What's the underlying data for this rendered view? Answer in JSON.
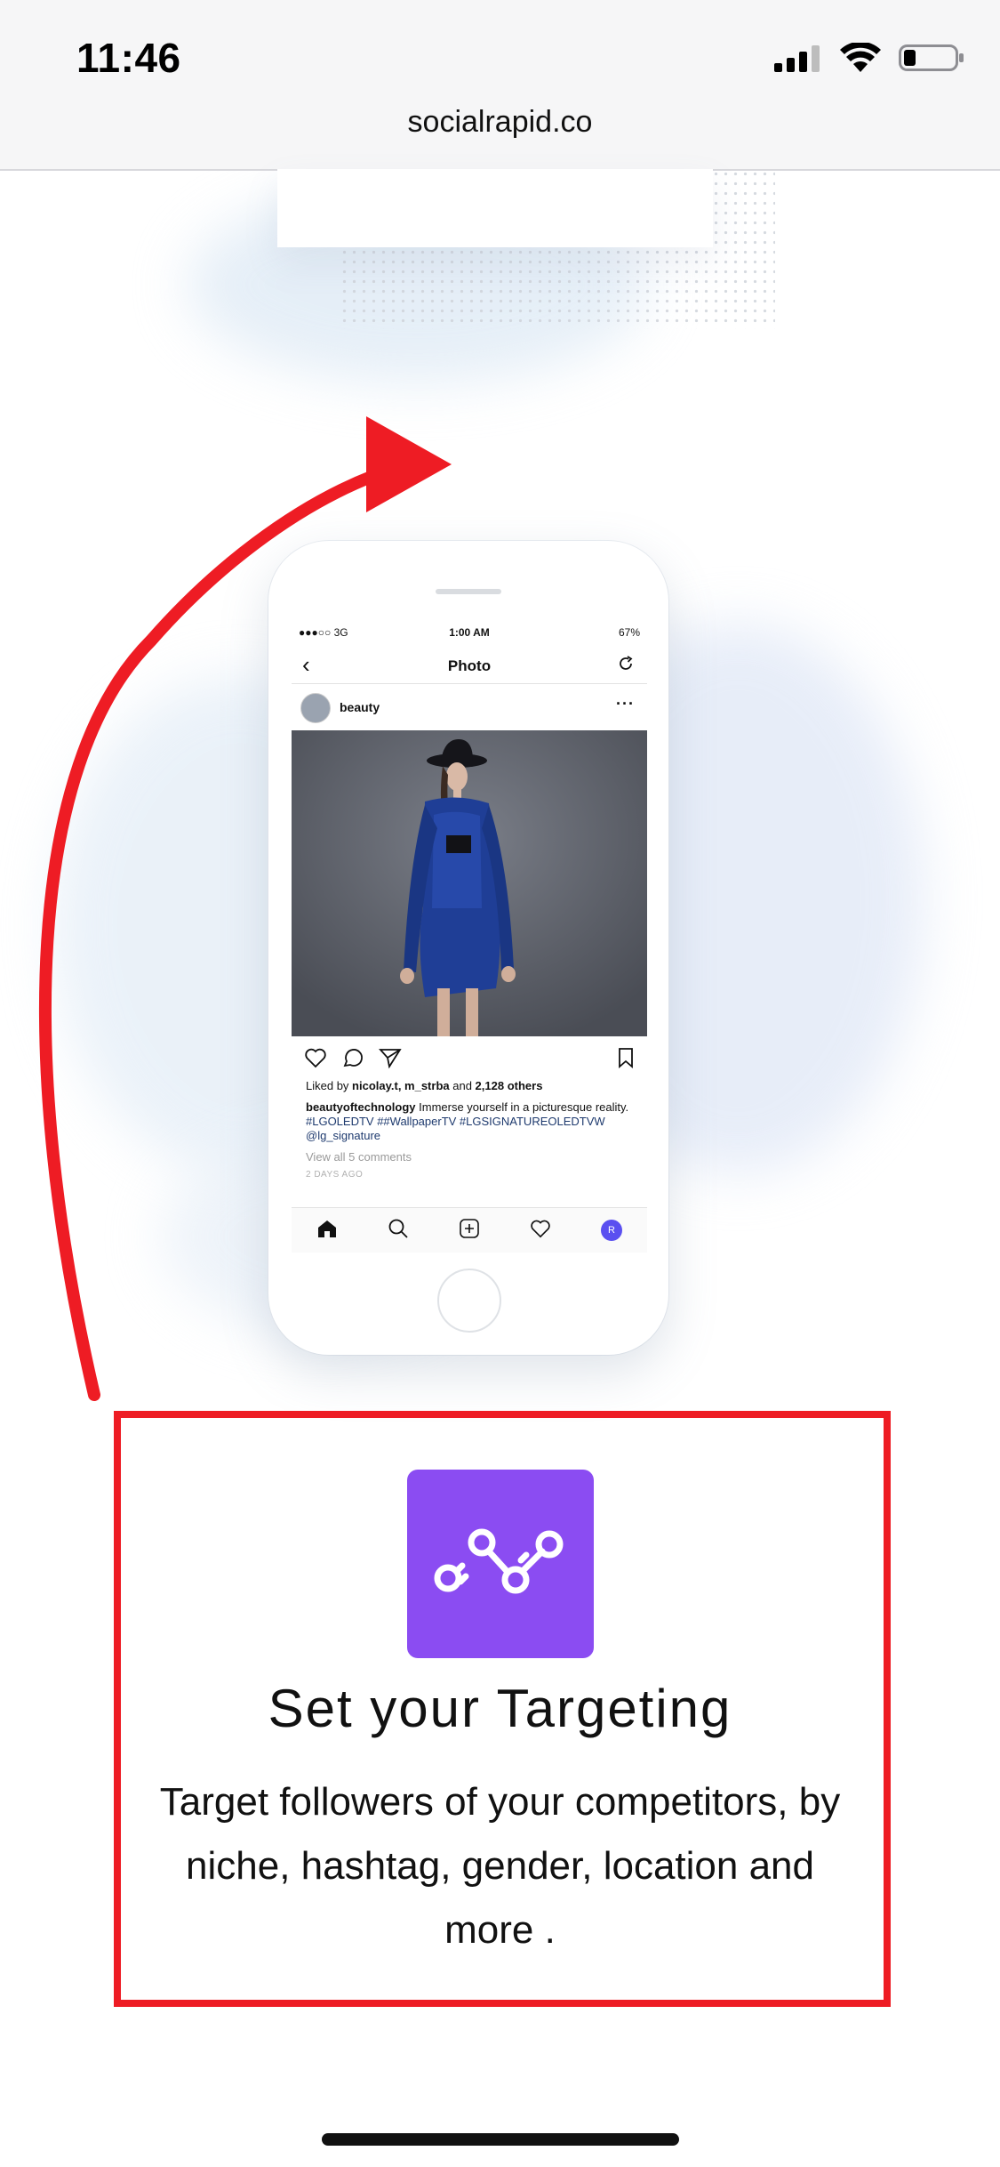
{
  "status_bar": {
    "time": "11:46",
    "battery_percent": 25
  },
  "browser": {
    "url": "socialrapid.co"
  },
  "phone_mockup": {
    "status": {
      "carrier": "●●●○○ 3G",
      "time": "1:00 AM",
      "battery": "67%"
    },
    "nav": {
      "title": "Photo"
    },
    "post": {
      "username": "beauty",
      "likes_prefix": "Liked by ",
      "likes_users": "nicolay.t, m_strba",
      "likes_and": " and ",
      "likes_count": "2,128 others",
      "caption_user": "beautyoftechnology",
      "caption_text": " Immerse yourself in a picturesque reality.",
      "hashtags": "#LGOLEDTV ##WallpaperTV #LGSIGNATUREOLEDTVW @lg_signature",
      "view_comments": "View all 5 comments",
      "age": "2 DAYS AGO"
    },
    "tabbar": {
      "profile_initial": "R"
    }
  },
  "feature": {
    "icon": "analytics-graph-icon",
    "title": "Set your Targeting",
    "description": "Target followers of your competitors, by niche, hashtag, gender, location and more ."
  },
  "colors": {
    "annotation_red": "#ee1c24",
    "icon_purple": "#8b4cf2",
    "ig_link_blue": "#1e3a6e",
    "profile_badge": "#5a4ff0"
  }
}
